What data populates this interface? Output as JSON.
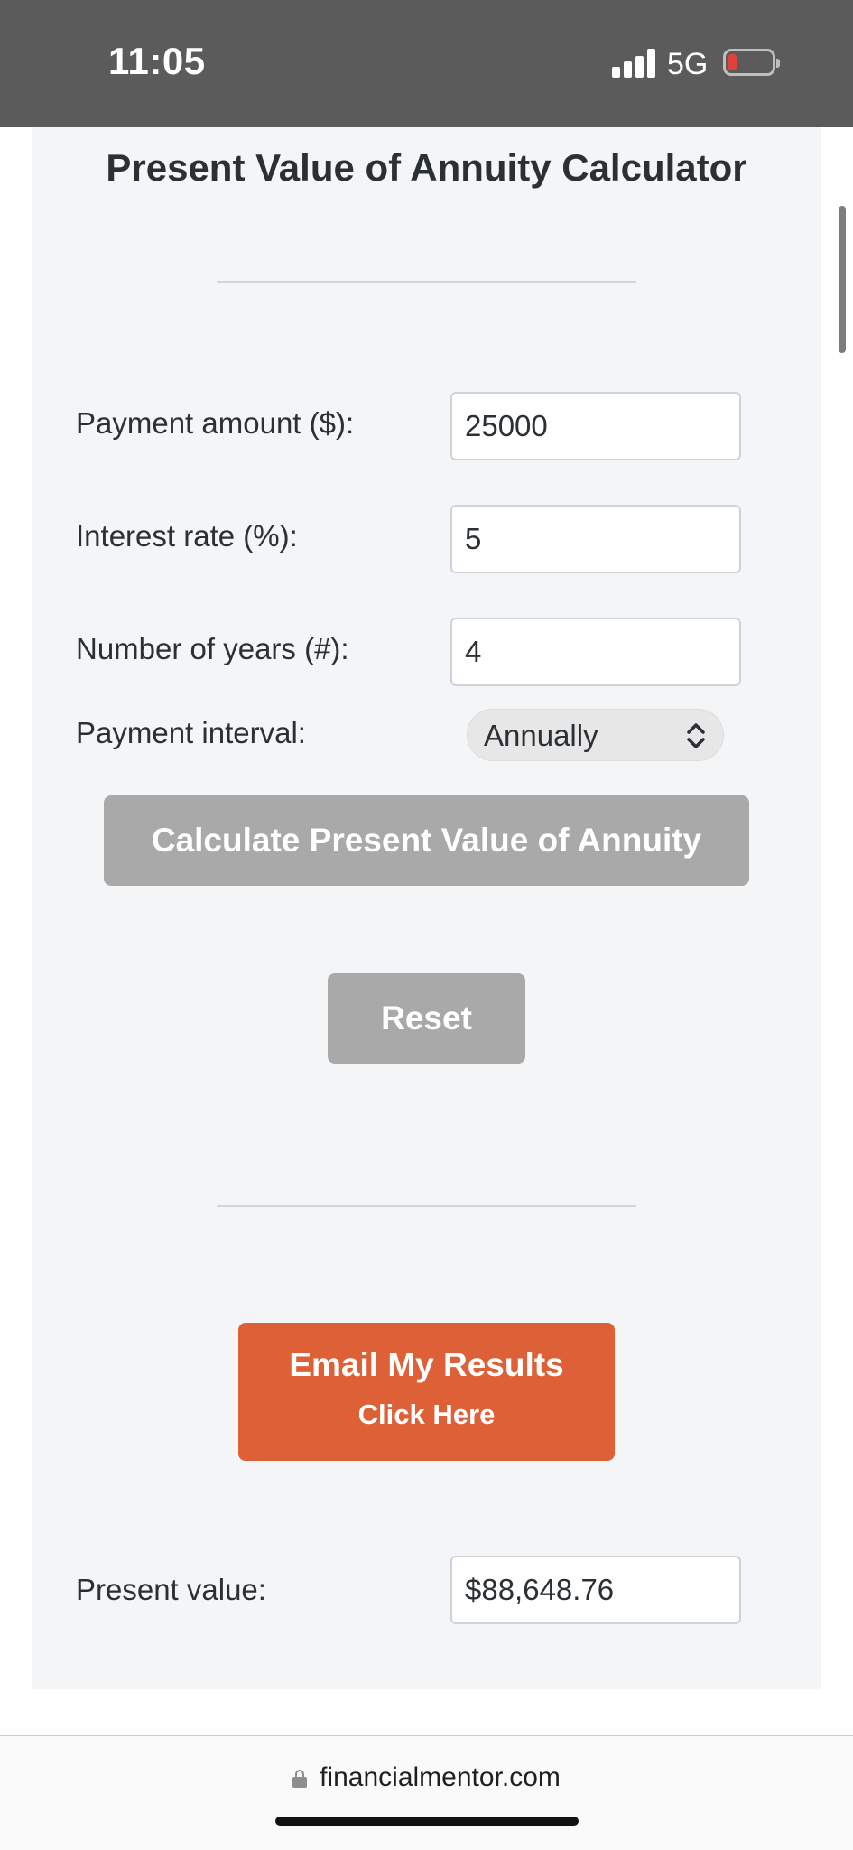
{
  "status_bar": {
    "time": "11:05",
    "network": "5G",
    "signal_icon": "signal-bars-icon",
    "battery_icon": "battery-low-icon",
    "battery_color": "#e0413a"
  },
  "calculator": {
    "title": "Present Value of Annuity Calculator",
    "fields": {
      "payment_amount": {
        "label": "Payment amount ($):",
        "value": "25000"
      },
      "interest_rate": {
        "label": "Interest rate (%):",
        "value": "5"
      },
      "number_of_years": {
        "label": "Number of years (#):",
        "value": "4"
      },
      "payment_interval": {
        "label": "Payment interval:",
        "selected": "Annually"
      }
    },
    "calculate_button": "Calculate Present Value of Annuity",
    "reset_button": "Reset",
    "email_button": {
      "line1": "Email My Results",
      "line2": "Click Here",
      "color": "#dd6037"
    },
    "result": {
      "label": "Present value:",
      "value": "$88,648.76"
    }
  },
  "browser": {
    "url": "financialmentor.com",
    "lock_icon": "lock-icon"
  }
}
